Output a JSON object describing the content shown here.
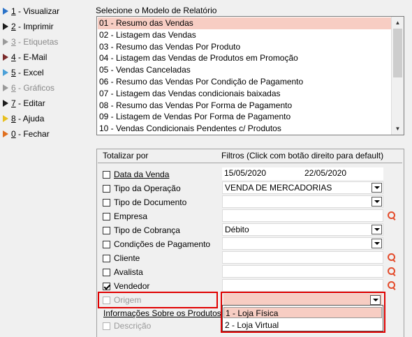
{
  "menu": {
    "items": [
      {
        "key": "1",
        "label": " - Visualizar",
        "icon": "blue-arrow-icon",
        "color": "#2a72c8",
        "disabled": false
      },
      {
        "key": "2",
        "label": " - Imprimir",
        "icon": "black-arrow-icon",
        "color": "#1c1c1c",
        "disabled": false
      },
      {
        "key": "3",
        "label": " - Etiquetas",
        "icon": "gray-arrow-icon",
        "color": "#9a9a9a",
        "disabled": true
      },
      {
        "key": "4",
        "label": " - E-Mail",
        "icon": "maroon-arrow-icon",
        "color": "#7a2a2a",
        "disabled": false
      },
      {
        "key": "5",
        "label": " - Excel",
        "icon": "blue-arrow-icon",
        "color": "#4aa0d8",
        "disabled": false
      },
      {
        "key": "6",
        "label": " - Gráficos",
        "icon": "gray-arrow-icon",
        "color": "#9a9a9a",
        "disabled": true
      },
      {
        "key": "7",
        "label": " - Editar",
        "icon": "black-arrow-icon",
        "color": "#1c1c1c",
        "disabled": false
      },
      {
        "key": "8",
        "label": " - Ajuda",
        "icon": "yellow-arrow-icon",
        "color": "#e8c020",
        "disabled": false
      },
      {
        "key": "0",
        "label": " - Fechar",
        "icon": "orange-arrow-icon",
        "color": "#e07020",
        "disabled": false
      }
    ]
  },
  "report_panel": {
    "title": "Selecione o Modelo de Relatório",
    "items": [
      "01 - Resumo das Vendas",
      "02 - Listagem das Vendas",
      "03 - Resumo das Vendas Por Produto",
      "04 - Listagem das Vendas de Produtos em Promoção",
      "05 - Vendas Canceladas",
      "06 - Resumo das Vendas Por Condição de Pagamento",
      "07 - Listagem das Vendas condicionais baixadas",
      "08 - Resumo das Vendas Por Forma de Pagamento",
      "09 - Listagem de Vendas Por Forma de Pagamento",
      "10 - Vendas Condicionais Pendentes c/ Produtos"
    ],
    "selected_index": 0
  },
  "filters": {
    "header_totalizar": "Totalizar por",
    "header_filtros": "Filtros (Click com botão direito para default)",
    "date_from": "15/05/2020",
    "date_to": "22/05/2020",
    "rows": [
      {
        "label": "Data da Venda",
        "checked": false,
        "underline": true,
        "disabled": false
      },
      {
        "label": "Tipo da Operação",
        "checked": false,
        "underline": false,
        "disabled": false
      },
      {
        "label": "Tipo de Documento",
        "checked": false,
        "underline": false,
        "disabled": false
      },
      {
        "label": "Empresa",
        "checked": false,
        "underline": false,
        "disabled": false
      },
      {
        "label": "Tipo de Cobrança",
        "checked": false,
        "underline": false,
        "disabled": false
      },
      {
        "label": "Condições de Pagamento",
        "checked": false,
        "underline": false,
        "disabled": false
      },
      {
        "label": "Cliente",
        "checked": false,
        "underline": false,
        "disabled": false
      },
      {
        "label": "Avalista",
        "checked": false,
        "underline": false,
        "disabled": false
      },
      {
        "label": "Vendedor",
        "checked": true,
        "underline": false,
        "disabled": false
      },
      {
        "label": "Origem",
        "checked": false,
        "underline": false,
        "disabled": true
      }
    ],
    "tipo_operacao_value": "VENDA DE MERCADORIAS",
    "tipo_documento_value": "",
    "tipo_cobranca_value": "Débito",
    "condicoes_value": "",
    "origem_value": "",
    "info_produtos_label": "Informações Sobre os Produtos",
    "descricao_label": "Descrição",
    "origem_options": [
      "1 - Loja Física",
      "2 - Loja Virtual"
    ]
  },
  "colors": {
    "selection": "#f7cdc3",
    "highlight_border": "#e00000",
    "search_icon": "#e44c2c"
  }
}
